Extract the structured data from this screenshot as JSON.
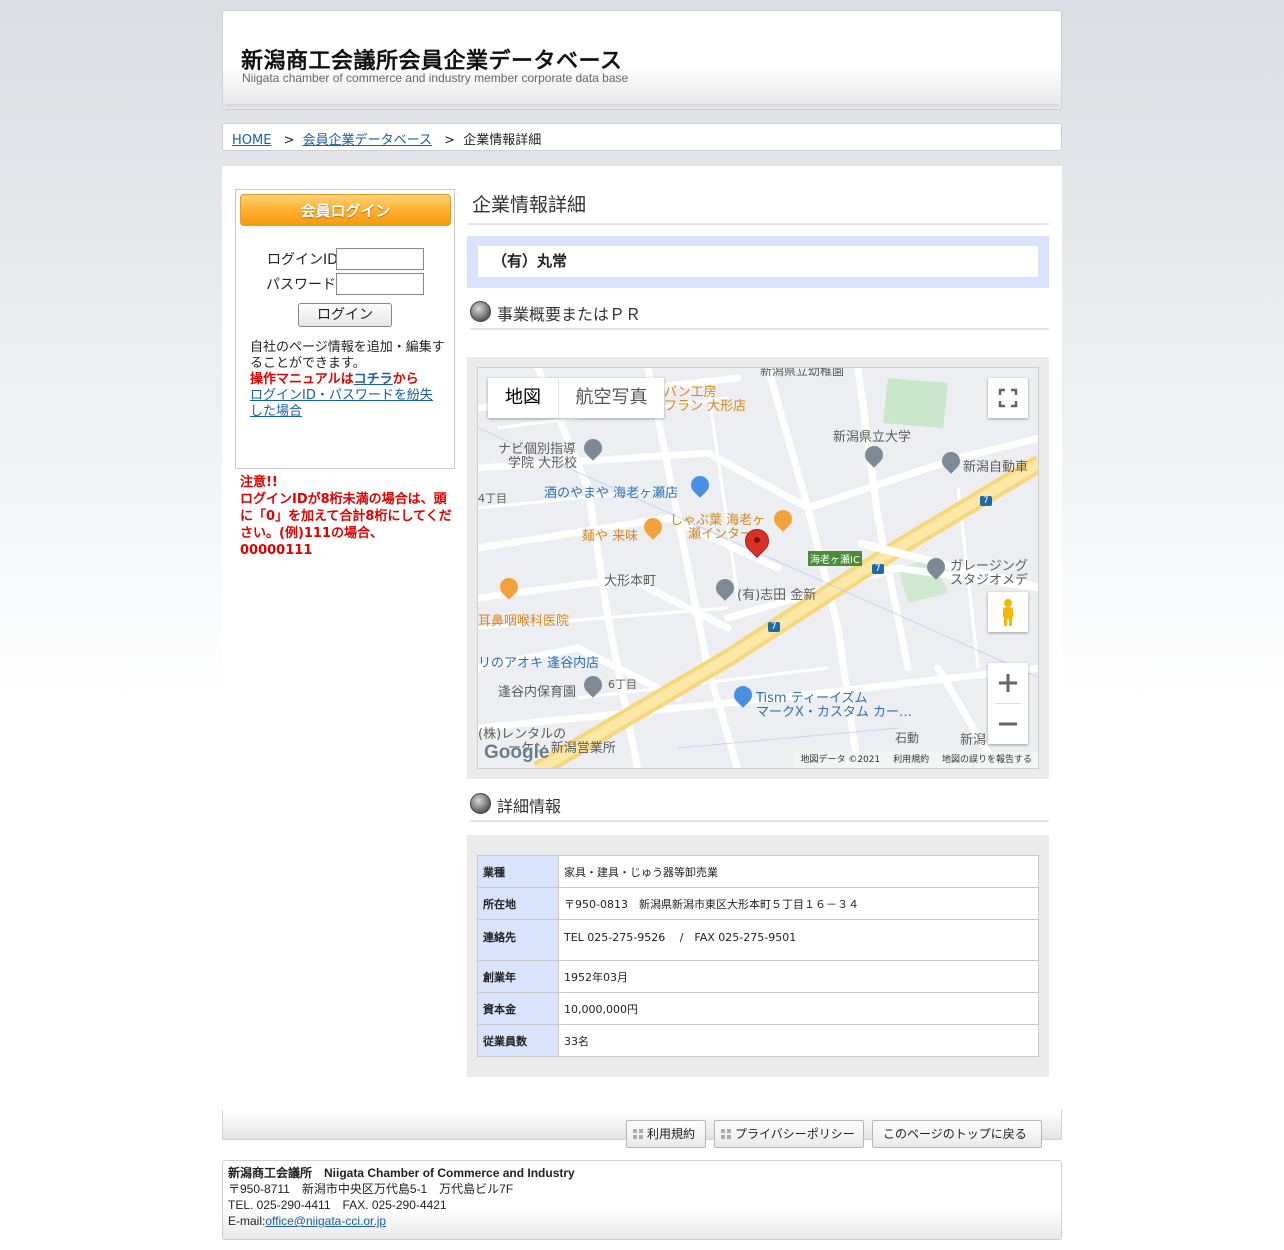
{
  "header": {
    "title": "新潟商工会議所会員企業データベース",
    "subtitle": "Niigata chamber of commerce and industry member corporate data base"
  },
  "breadcrumb": {
    "home": "HOME",
    "database": "会員企業データベース",
    "current": "企業情報詳細",
    "separator": ">"
  },
  "sidebar": {
    "login_header": "会員ログイン",
    "login_id_label": "ログインID",
    "password_label": "パスワード",
    "login_button": "ログイン",
    "note_line": "自社のページ情報を追加・編集することができます。",
    "manual_prefix": "操作マニュアルは",
    "manual_link": "コチラ",
    "manual_suffix": "から",
    "lost_link": "ログインID・パスワードを紛失した場合",
    "warning_title": "注意!!",
    "warning_text": "ログインIDが8桁未満の場合は、頭に「0」を加えて合計8桁にしてください。(例)111の場合、00000111"
  },
  "content": {
    "page_title": "企業情報詳細",
    "company_name": "（有）丸常",
    "section_pr": "事業概要またはＰＲ",
    "section_details": "詳細情報"
  },
  "map": {
    "tab_map": "地図",
    "tab_satellite": "航空写真",
    "attribution": "地図データ ©2021",
    "terms": "利用規約",
    "report": "地図の誤りを報告する",
    "logo": "Google",
    "labels": {
      "kindergarten": "新潟県立幼稚園",
      "bakery": "パン工房",
      "bakery2": "フラン 大形店",
      "univ": "新潟県立大学",
      "navi1": "ナビ個別指導",
      "navi2": "学院 大形校",
      "jidosha": "新潟自動車",
      "chome4": "4丁目",
      "sake": "酒のやまや 海老ヶ瀬店",
      "shabu1": "しゃぶ葉 海老ヶ",
      "shabu2": "瀬インター",
      "menya": "麺や 来味",
      "ic": "海老ヶ瀬IC",
      "garage1": "ガレージング",
      "garage2": "スタジオメデ",
      "ohgata": "大形本町",
      "shida": "(有)志田 金新",
      "jibi": "耳鼻咽喉科医院",
      "aoki": "リのアオキ 逢谷内店",
      "chome6": "6丁目",
      "hoiku": "逢谷内保育園",
      "tism1": "Tism ティーイズム",
      "tism2": "マークX・カスタム カー…",
      "rental1": "(株)レンタルの",
      "rental2": "ーケン 新潟営業所",
      "ishidou": "石動",
      "niigata": "新潟",
      "route": "7"
    }
  },
  "details": {
    "rows": [
      {
        "label": "業種",
        "value": "家具・建具・じゅう器等卸売業"
      },
      {
        "label": "所在地",
        "value": "〒950-0813　新潟県新潟市東区大形本町５丁目１６－３４"
      },
      {
        "label": "連絡先",
        "value": "TEL 025-275-9526　 /　FAX 025-275-9501"
      },
      {
        "label": "創業年",
        "value": "1952年03月"
      },
      {
        "label": "資本金",
        "value": "10,000,000円"
      },
      {
        "label": "従業員数",
        "value": "33名"
      }
    ]
  },
  "footer": {
    "terms": "利用規約",
    "privacy": "プライバシーポリシー",
    "top": "このページのトップに戻る",
    "org": "新潟商工会議所　Niigata Chamber of Commerce and Industry",
    "address": "〒950-8711　新潟市中央区万代島5-1　万代島ビル7F",
    "tel": "TEL. 025-290-4411　FAX. 025-290-4421",
    "email_label": "E-mail:",
    "email": "office@niigata-cci.or.jp"
  },
  "colors": {
    "accent_orange": "#f59a10",
    "panel_blue": "#d9e3fb",
    "warning_red": "#e00000",
    "link_blue": "#1a5ea8",
    "map_pin_red": "#d9302a"
  }
}
